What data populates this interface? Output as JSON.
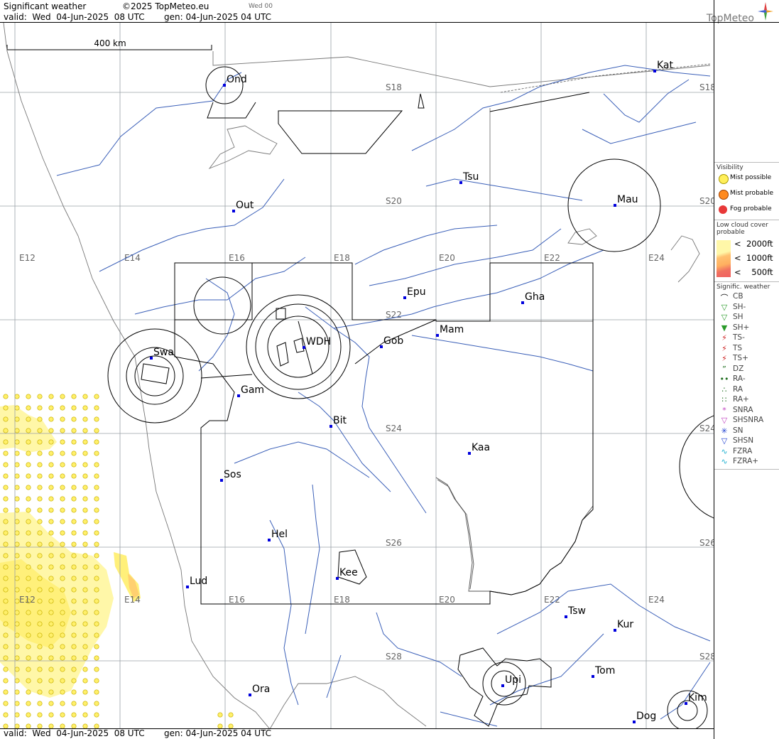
{
  "header": {
    "title": "Significant weather",
    "copyright": "©2025 TopMeteo.eu",
    "run_tag": "Wed 00",
    "valid": "valid:  Wed  04-Jun-2025  08 UTC",
    "generated": "gen: 04-Jun-2025 04 UTC",
    "brand": "TopMeteo"
  },
  "footer": {
    "valid": "valid:  Wed  04-Jun-2025  08 UTC",
    "generated": "gen: 04-Jun-2025 04 UTC"
  },
  "map": {
    "scale_label": "400 km",
    "lon_labels": [
      "E12",
      "E14",
      "E16",
      "E18",
      "E20",
      "E22",
      "E24"
    ],
    "lat_labels": [
      "S18",
      "S20",
      "S22",
      "S24",
      "S26",
      "S28"
    ],
    "places": [
      {
        "name": "Ond"
      },
      {
        "name": "Kat"
      },
      {
        "name": "Tsu"
      },
      {
        "name": "Out"
      },
      {
        "name": "Mau"
      },
      {
        "name": "Epu"
      },
      {
        "name": "Gha"
      },
      {
        "name": "Mam"
      },
      {
        "name": "Gob"
      },
      {
        "name": "WDH"
      },
      {
        "name": "Swa"
      },
      {
        "name": "Gam"
      },
      {
        "name": "Bit"
      },
      {
        "name": "Kaa"
      },
      {
        "name": "Sos"
      },
      {
        "name": "Hel"
      },
      {
        "name": "Kee"
      },
      {
        "name": "Lud"
      },
      {
        "name": "Tsw"
      },
      {
        "name": "Kur"
      },
      {
        "name": "Tom"
      },
      {
        "name": "Upi"
      },
      {
        "name": "Ora"
      },
      {
        "name": "Kim"
      },
      {
        "name": "Dog"
      }
    ]
  },
  "legend": {
    "visibility_title": "Visibility",
    "visibility": [
      {
        "label": "Mist possible",
        "color": "#ffef5a"
      },
      {
        "label": "Mist probable",
        "color": "#ff8a20"
      },
      {
        "label": "Fog probable",
        "color": "#e83838"
      }
    ],
    "cloud_title": "Low cloud cover probable",
    "cloud": [
      "<  2000ft",
      "<  1000ft",
      "<    500ft"
    ],
    "sigwx_title": "Signific. weather",
    "sigwx": [
      {
        "label": "CB",
        "icon": "cb-icon"
      },
      {
        "label": "SH-",
        "icon": "shower-light-icon"
      },
      {
        "label": "SH",
        "icon": "shower-icon"
      },
      {
        "label": "SH+",
        "icon": "shower-heavy-icon"
      },
      {
        "label": "TS-",
        "icon": "thunderstorm-light-icon"
      },
      {
        "label": "TS",
        "icon": "thunderstorm-icon"
      },
      {
        "label": "TS+",
        "icon": "thunderstorm-heavy-icon"
      },
      {
        "label": "DZ",
        "icon": "drizzle-icon"
      },
      {
        "label": "RA-",
        "icon": "rain-light-icon"
      },
      {
        "label": "RA",
        "icon": "rain-icon"
      },
      {
        "label": "RA+",
        "icon": "rain-heavy-icon"
      },
      {
        "label": "SNRA",
        "icon": "snow-rain-icon"
      },
      {
        "label": "SHSNRA",
        "icon": "snow-rain-shower-icon"
      },
      {
        "label": "SN",
        "icon": "snow-icon"
      },
      {
        "label": "SHSN",
        "icon": "snow-shower-icon"
      },
      {
        "label": "FZRA",
        "icon": "freezing-rain-icon"
      },
      {
        "label": "FZRA+",
        "icon": "freezing-rain-heavy-icon"
      }
    ]
  }
}
